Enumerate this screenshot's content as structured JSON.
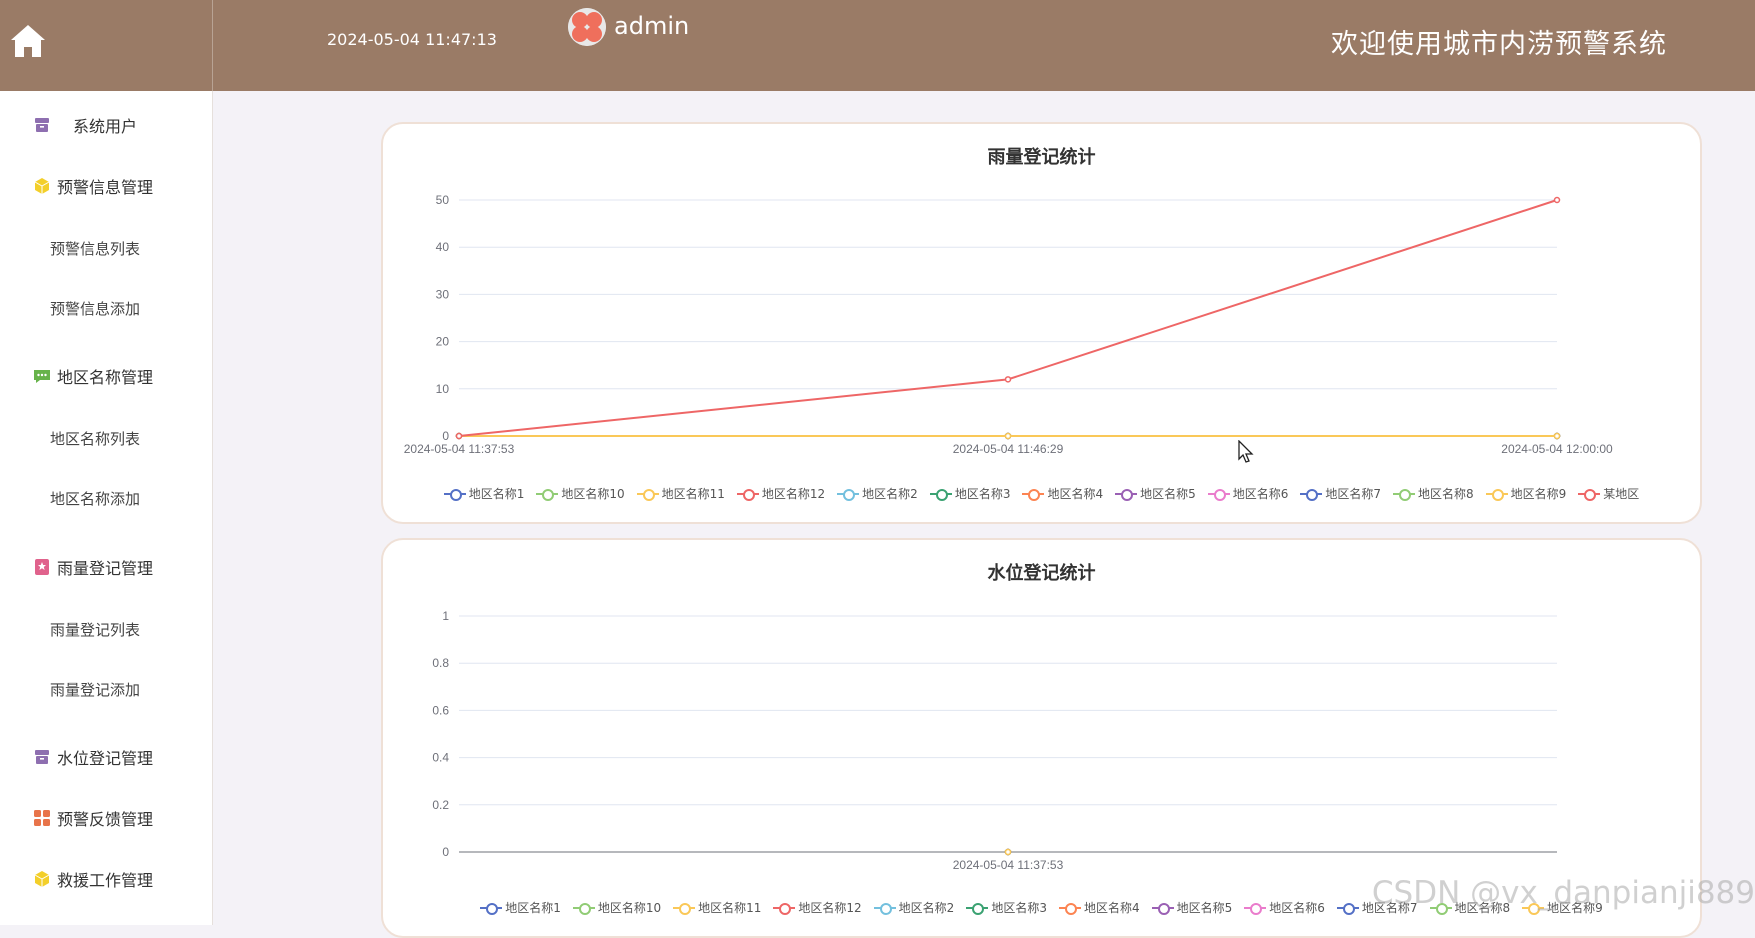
{
  "header": {
    "datetime": "2024-05-04 11:47:13",
    "username": "admin",
    "site_title": "欢迎使用城市内涝预警系统"
  },
  "sidebar": {
    "items": [
      {
        "label": "系统用户",
        "icon": "archive-icon",
        "color": "#8e6fb0",
        "level": "top"
      },
      {
        "label": "预警信息管理",
        "icon": "cube-icon",
        "color": "#f3cf2a",
        "level": "top"
      },
      {
        "label": "预警信息列表",
        "level": "sub"
      },
      {
        "label": "预警信息添加",
        "level": "sub"
      },
      {
        "label": "地区名称管理",
        "icon": "chat-icon",
        "color": "#67b34a",
        "level": "top"
      },
      {
        "label": "地区名称列表",
        "level": "sub"
      },
      {
        "label": "地区名称添加",
        "level": "sub"
      },
      {
        "label": "雨量登记管理",
        "icon": "badge-icon",
        "color": "#e0628c",
        "level": "top"
      },
      {
        "label": "雨量登记列表",
        "level": "sub"
      },
      {
        "label": "雨量登记添加",
        "level": "sub"
      },
      {
        "label": "水位登记管理",
        "icon": "archive-icon",
        "color": "#8e6fb0",
        "level": "top"
      },
      {
        "label": "预警反馈管理",
        "icon": "grid-icon",
        "color": "#e8744a",
        "level": "top"
      },
      {
        "label": "救援工作管理",
        "icon": "cube-icon",
        "color": "#f3cf2a",
        "level": "top"
      }
    ]
  },
  "chart_data": [
    {
      "type": "line",
      "title": "雨量登记统计",
      "categories": [
        "2024-05-04 11:37:53",
        "2024-05-04 11:46:29",
        "2024-05-04 12:00:00"
      ],
      "ylim": [
        0,
        50
      ],
      "yticks": [
        "0",
        "10",
        "20",
        "30",
        "40",
        "50"
      ],
      "grid": true,
      "legend_position": "bottom",
      "series": [
        {
          "name": "地区名称1",
          "color": "#5470c6",
          "values": [
            0,
            0,
            0
          ]
        },
        {
          "name": "地区名称10",
          "color": "#91cc75",
          "values": [
            0,
            0,
            0
          ]
        },
        {
          "name": "地区名称11",
          "color": "#fac858",
          "values": [
            0,
            0,
            0
          ]
        },
        {
          "name": "地区名称12",
          "color": "#ee6666",
          "values": [
            0,
            0,
            0
          ]
        },
        {
          "name": "地区名称2",
          "color": "#73c0de",
          "values": [
            0,
            0,
            0
          ]
        },
        {
          "name": "地区名称3",
          "color": "#3ba272",
          "values": [
            0,
            0,
            0
          ]
        },
        {
          "name": "地区名称4",
          "color": "#fc8452",
          "values": [
            0,
            0,
            0
          ]
        },
        {
          "name": "地区名称5",
          "color": "#9a60b4",
          "values": [
            0,
            0,
            0
          ]
        },
        {
          "name": "地区名称6",
          "color": "#ea7ccc",
          "values": [
            0,
            0,
            0
          ]
        },
        {
          "name": "地区名称7",
          "color": "#5470c6",
          "values": [
            0,
            0,
            0
          ]
        },
        {
          "name": "地区名称8",
          "color": "#91cc75",
          "values": [
            0,
            0,
            0
          ]
        },
        {
          "name": "地区名称9",
          "color": "#fac858",
          "values": [
            0,
            0,
            0
          ]
        },
        {
          "name": "某地区",
          "color": "#ee6666",
          "values": [
            0,
            12,
            50
          ]
        }
      ]
    },
    {
      "type": "line",
      "title": "水位登记统计",
      "categories": [
        "2024-05-04 11:37:53"
      ],
      "ylim": [
        0,
        1
      ],
      "yticks": [
        "0",
        "0.2",
        "0.4",
        "0.6",
        "0.8",
        "1"
      ],
      "grid": true,
      "legend_position": "bottom",
      "series": [
        {
          "name": "地区名称1",
          "color": "#5470c6",
          "values": [
            0
          ]
        },
        {
          "name": "地区名称10",
          "color": "#91cc75",
          "values": [
            0
          ]
        },
        {
          "name": "地区名称11",
          "color": "#fac858",
          "values": [
            0
          ]
        },
        {
          "name": "地区名称12",
          "color": "#ee6666",
          "values": [
            0
          ]
        },
        {
          "name": "地区名称2",
          "color": "#73c0de",
          "values": [
            0
          ]
        },
        {
          "name": "地区名称3",
          "color": "#3ba272",
          "values": [
            0
          ]
        },
        {
          "name": "地区名称4",
          "color": "#fc8452",
          "values": [
            0
          ]
        },
        {
          "name": "地区名称5",
          "color": "#9a60b4",
          "values": [
            0
          ]
        },
        {
          "name": "地区名称6",
          "color": "#ea7ccc",
          "values": [
            0
          ]
        },
        {
          "name": "地区名称7",
          "color": "#5470c6",
          "values": [
            0
          ]
        },
        {
          "name": "地区名称8",
          "color": "#91cc75",
          "values": [
            0
          ]
        },
        {
          "name": "地区名称9",
          "color": "#fac858",
          "values": [
            0
          ]
        }
      ]
    }
  ],
  "watermark": "CSDN @vx_danpianji889"
}
